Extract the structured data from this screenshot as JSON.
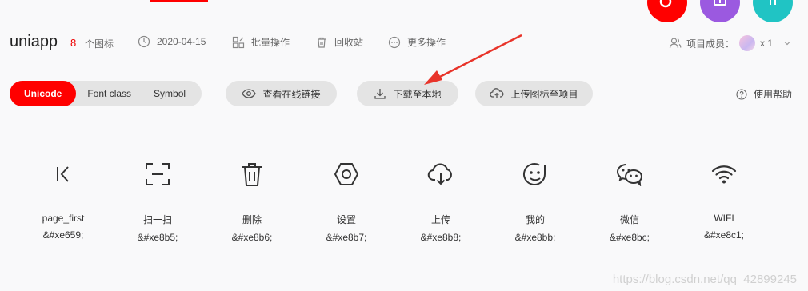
{
  "header": {
    "project_name": "uniapp",
    "icon_count": "8",
    "icon_count_label": "个图标",
    "date": "2020-04-15",
    "batch_ops": "批量操作",
    "recycle_bin": "回收站",
    "more_ops": "更多操作",
    "members_label": "项目成员：",
    "members_count": "x 1"
  },
  "toolbar": {
    "tabs": [
      {
        "label": "Unicode",
        "active": true
      },
      {
        "label": "Font class",
        "active": false
      },
      {
        "label": "Symbol",
        "active": false
      }
    ],
    "view_link": "查看在线链接",
    "download": "下载至本地",
    "upload": "上传图标至项目",
    "help": "使用帮助"
  },
  "icons": [
    {
      "name": "page_first",
      "code": "&#xe659;",
      "icon": "page-first-icon"
    },
    {
      "name": "扫一扫",
      "code": "&#xe8b5;",
      "icon": "scan-icon"
    },
    {
      "name": "删除",
      "code": "&#xe8b6;",
      "icon": "trash-icon"
    },
    {
      "name": "设置",
      "code": "&#xe8b7;",
      "icon": "settings-icon"
    },
    {
      "name": "上传",
      "code": "&#xe8b8;",
      "icon": "cloud-upload-icon"
    },
    {
      "name": "我的",
      "code": "&#xe8bb;",
      "icon": "smile-icon"
    },
    {
      "name": "微信",
      "code": "&#xe8bc;",
      "icon": "wechat-icon"
    },
    {
      "name": "WIFI",
      "code": "&#xe8c1;",
      "icon": "wifi-icon"
    }
  ],
  "watermark": "https://blog.csdn.net/qq_42899245",
  "colors": {
    "accent": "#ff0000",
    "fab_purple": "#9b59e0",
    "fab_teal": "#20c4c4"
  }
}
